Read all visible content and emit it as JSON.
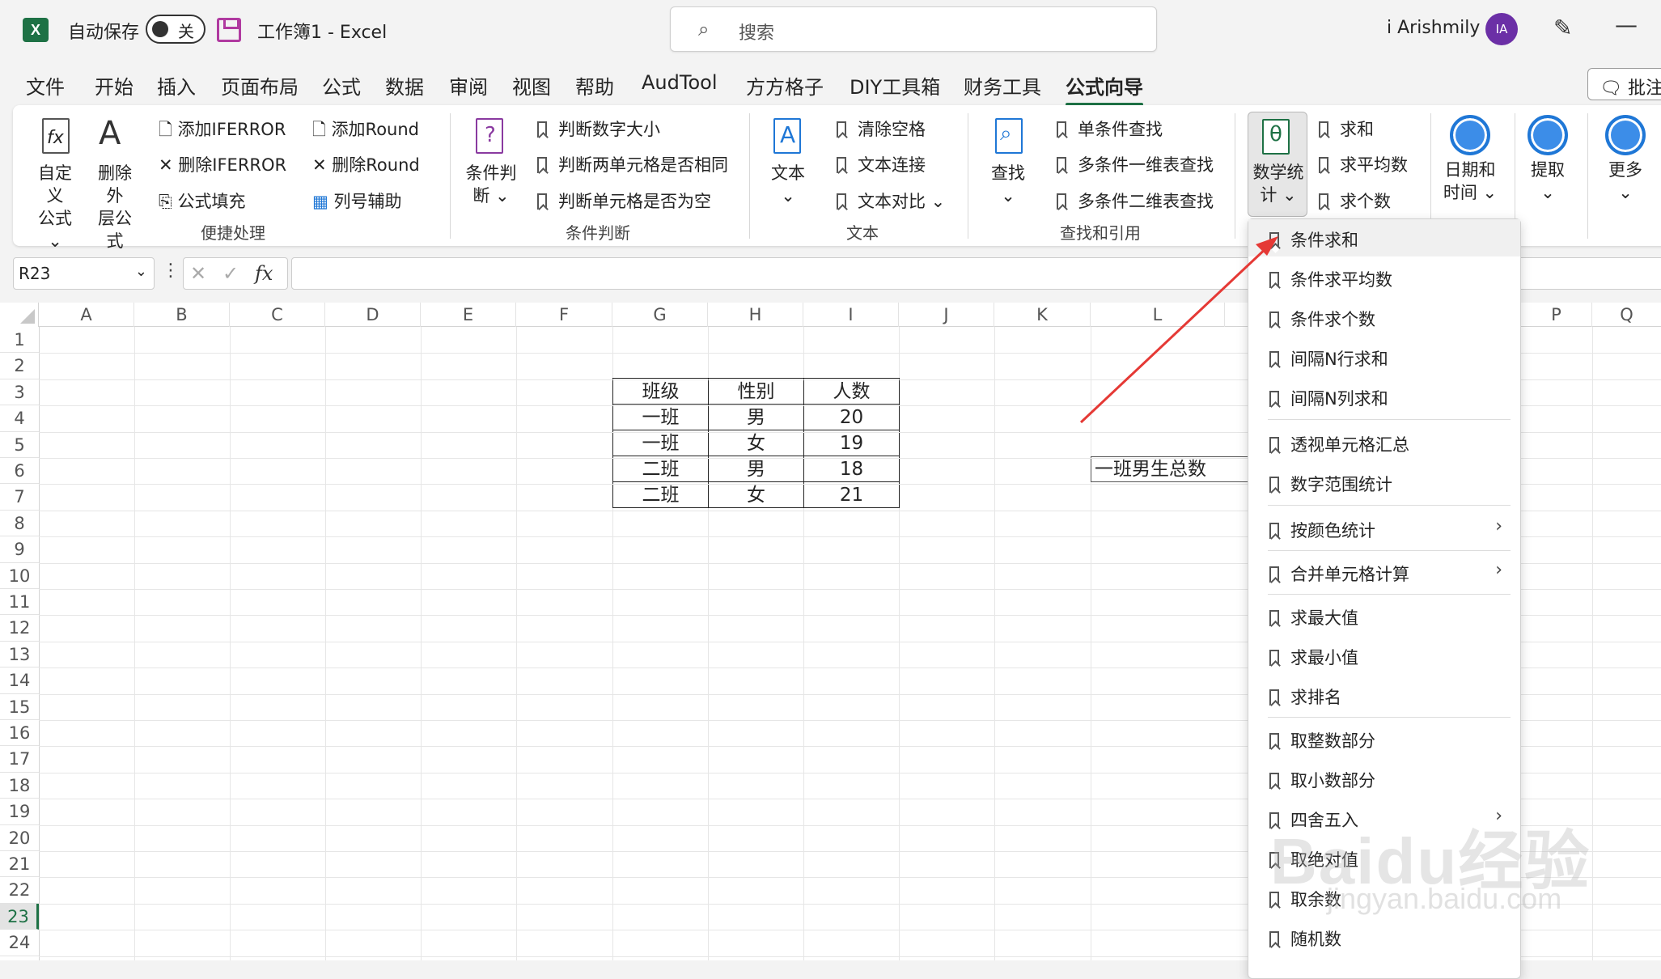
{
  "titlebar": {
    "autosave_label": "自动保存",
    "autosave_state": "关",
    "doc_title": "工作簿1  -  Excel",
    "search_placeholder": "搜索",
    "user_name": "i Arishmily",
    "avatar_initials": "IA"
  },
  "menu_tabs": [
    "文件",
    "开始",
    "插入",
    "页面布局",
    "公式",
    "数据",
    "审阅",
    "视图",
    "帮助",
    "AudTool",
    "方方格子",
    "DIY工具箱",
    "财务工具",
    "公式向导"
  ],
  "active_tab": "公式向导",
  "comments_label": "批注",
  "ribbon": {
    "group1": {
      "label": "便捷处理",
      "custom_formula": [
        "自定义",
        "公式 ⌄"
      ],
      "remove_outer": [
        "删除外",
        "层公式"
      ],
      "add_iferror": "添加IFERROR",
      "remove_iferror": "删除IFERROR",
      "formula_fill": "公式填充",
      "add_round": "添加Round",
      "remove_round": "删除Round",
      "col_helper": "列号辅助"
    },
    "group2": {
      "label": "条件判断",
      "big": [
        "条件判",
        "断 ⌄"
      ],
      "items": [
        "判断数字大小",
        "判断两单元格是否相同",
        "判断单元格是否为空"
      ]
    },
    "group3": {
      "label": "文本",
      "big": [
        "文本",
        "⌄"
      ],
      "items": [
        "清除空格",
        "文本连接",
        "文本对比"
      ]
    },
    "group4": {
      "label": "查找和引用",
      "big": [
        "查找",
        "⌄"
      ],
      "items": [
        "单条件查找",
        "多条件一维表查找",
        "多条件二维表查找"
      ]
    },
    "group5": {
      "big": [
        "数学统",
        "计 ⌄"
      ],
      "items": [
        "求和",
        "求平均数",
        "求个数"
      ]
    },
    "date_time": [
      "日期和",
      "时间 ⌄"
    ],
    "extract": [
      "提取",
      "⌄"
    ],
    "more": [
      "更多",
      "⌄"
    ]
  },
  "formula_bar": {
    "name_box": "R23",
    "fx": "fx"
  },
  "grid": {
    "columns": [
      "A",
      "B",
      "C",
      "D",
      "E",
      "F",
      "G",
      "H",
      "I",
      "J",
      "K",
      "L",
      "P",
      "Q"
    ],
    "rows": [
      "1",
      "2",
      "3",
      "4",
      "5",
      "6",
      "7",
      "8",
      "9",
      "10",
      "11",
      "12",
      "13",
      "14",
      "15",
      "16",
      "17",
      "18",
      "19",
      "20",
      "21",
      "22",
      "23",
      "24"
    ],
    "selected_row": "23",
    "table": [
      [
        "班级",
        "性别",
        "人数"
      ],
      [
        "一班",
        "男",
        "20"
      ],
      [
        "一班",
        "女",
        "19"
      ],
      [
        "二班",
        "男",
        "18"
      ],
      [
        "二班",
        "女",
        "21"
      ]
    ],
    "l6_text": "一班男生总数"
  },
  "dropdown": {
    "items": [
      "条件求和",
      "条件求平均数",
      "条件求个数",
      "间隔N行求和",
      "间隔N列求和",
      "透视单元格汇总",
      "数字范围统计",
      "按颜色统计",
      "合并单元格计算",
      "求最大值",
      "求最小值",
      "求排名",
      "取整数部分",
      "取小数部分",
      "四舍五入",
      "取绝对值",
      "取余数",
      "随机数"
    ]
  },
  "watermark": "Baidu经验",
  "watermark_sub": "jingyan.baidu.com",
  "colors": {
    "excel_green": "#1e7145",
    "accent_blue": "#1f77d6",
    "arrow_red": "#e53935"
  }
}
